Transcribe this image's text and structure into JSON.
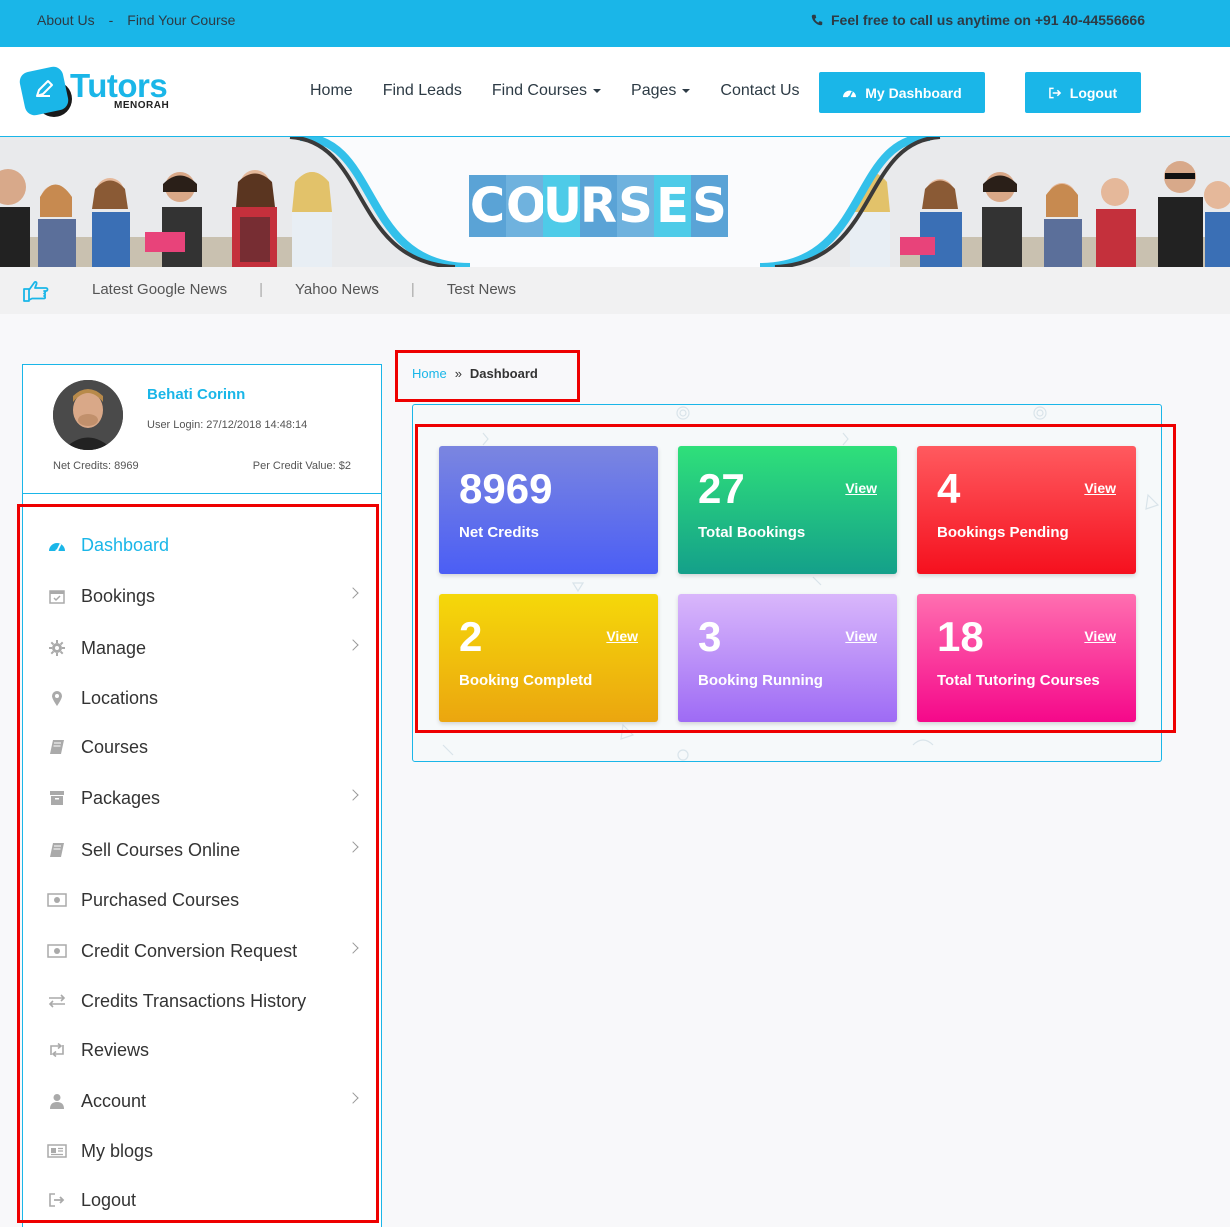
{
  "topbar": {
    "about": "About Us",
    "separator": "-",
    "find_course": "Find Your Course",
    "call_text": "Feel free to call us anytime on +91 40-44556666",
    "phone_icon": "phone-icon"
  },
  "logo": {
    "name": "Tutors",
    "sub": "MENORAH"
  },
  "nav": {
    "home": "Home",
    "find_leads": "Find Leads",
    "find_courses": "Find Courses",
    "pages": "Pages",
    "contact": "Contact Us"
  },
  "buttons": {
    "dashboard": "My Dashboard",
    "logout": "Logout"
  },
  "banner": {
    "letters": [
      "C",
      "O",
      "U",
      "R",
      "S",
      "E",
      "S"
    ],
    "letter_colors": [
      "#5aa3d6",
      "#6fb2de",
      "#4ecbe8",
      "#5aa3d6",
      "#6fb2de",
      "#4ecbe8",
      "#5aa3d6"
    ]
  },
  "news": {
    "links": [
      "Latest Google News",
      "Yahoo News",
      "Test News"
    ],
    "pipe": "|"
  },
  "profile": {
    "name": "Behati Corinn",
    "login": "User Login: 27/12/2018 14:48:14",
    "net_credits": "Net Credits: 8969",
    "per_credit": "Per Credit Value: $2"
  },
  "sidebar": {
    "items": [
      {
        "label": "Dashboard",
        "icon": "dashboard-icon",
        "chevron": false,
        "active": true
      },
      {
        "label": "Bookings",
        "icon": "calendar-icon",
        "chevron": true,
        "active": false
      },
      {
        "label": "Manage",
        "icon": "gear-icon",
        "chevron": true,
        "active": false
      },
      {
        "label": "Locations",
        "icon": "map-pin-icon",
        "chevron": false,
        "active": false
      },
      {
        "label": "Courses",
        "icon": "book-icon",
        "chevron": false,
        "active": false
      },
      {
        "label": "Packages",
        "icon": "archive-icon",
        "chevron": true,
        "active": false
      },
      {
        "label": "Sell Courses Online",
        "icon": "book-icon",
        "chevron": true,
        "active": false
      },
      {
        "label": "Purchased Courses",
        "icon": "money-icon",
        "chevron": false,
        "active": false
      },
      {
        "label": "Credit Conversion Request",
        "icon": "money-icon",
        "chevron": true,
        "active": false
      },
      {
        "label": "Credits Transactions History",
        "icon": "exchange-icon",
        "chevron": false,
        "active": false
      },
      {
        "label": "Reviews",
        "icon": "retweet-icon",
        "chevron": false,
        "active": false
      },
      {
        "label": "Account",
        "icon": "user-icon",
        "chevron": true,
        "active": false
      },
      {
        "label": "My blogs",
        "icon": "newspaper-icon",
        "chevron": false,
        "active": false
      },
      {
        "label": "Logout",
        "icon": "sign-out-icon",
        "chevron": false,
        "active": false
      }
    ]
  },
  "breadcrumb": {
    "home": "Home",
    "sep": "»",
    "current": "Dashboard"
  },
  "stats": [
    {
      "value": "8969",
      "label": "Net Credits",
      "view": "",
      "gradient": [
        "#7b86e0",
        "#4b5ef5"
      ]
    },
    {
      "value": "27",
      "label": "Total Bookings",
      "view": "View",
      "gradient": [
        "#2fe07a",
        "#14a08a"
      ]
    },
    {
      "value": "4",
      "label": "Bookings Pending",
      "view": "View",
      "gradient": [
        "#ff5a5f",
        "#f5101e"
      ]
    },
    {
      "value": "2",
      "label": "Booking Completd",
      "view": "View",
      "gradient": [
        "#f5d80a",
        "#eba60f"
      ]
    },
    {
      "value": "3",
      "label": "Booking Running",
      "view": "View",
      "gradient": [
        "#d9b7fb",
        "#9e6bf5"
      ]
    },
    {
      "value": "18",
      "label": "Total Tutoring Courses",
      "view": "View",
      "gradient": [
        "#ff6fb0",
        "#f5088a"
      ]
    }
  ],
  "colors": {
    "accent": "#1ab6e8",
    "highlight": "#e00000"
  }
}
